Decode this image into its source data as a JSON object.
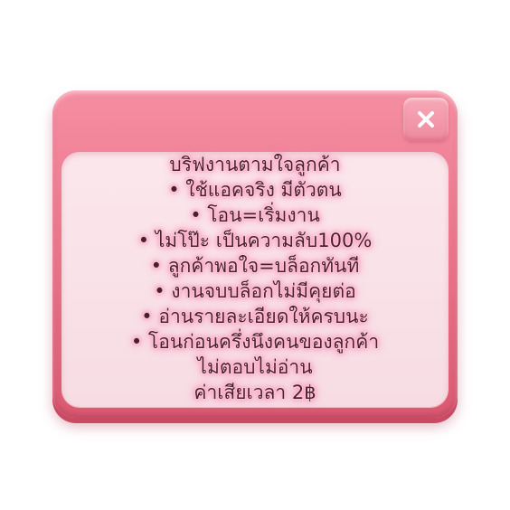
{
  "dialog": {
    "close_icon": "close-icon",
    "lines": [
      "บริฟงานตามใจลูกค้า",
      "• ใช้แอคจริง มีตัวตน",
      "• โอน=เริ่มงาน",
      "• ไม่โป๊ะ  เป็นความลับ100%",
      "• ลูกค้าพอใจ=บล็อกทันที",
      "• งานจบบล็อกไม่มีคุยต่อ",
      "• อ่านรายละเอียดให้ครบนะ",
      "• โอนก่อนครึ่งนึงคนของลูกค้า",
      "ไม่ตอบไม่อ่าน",
      "ค่าเสียเวลา 2฿"
    ]
  },
  "colors": {
    "frame": "#ea7288",
    "frame_shadow": "#c94a63",
    "panel": "#fbe7ec",
    "text": "#4a1f2e",
    "glow": "#ff8ab2"
  }
}
